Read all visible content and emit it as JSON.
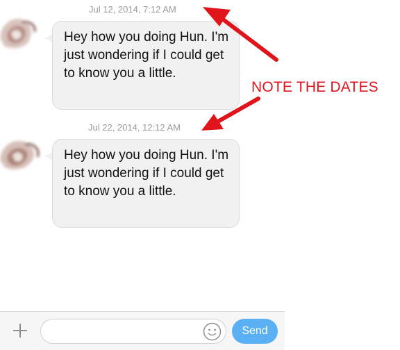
{
  "messages": [
    {
      "timestamp": "Jul 12, 2014, 7:12 AM",
      "text": "Hey how you doing Hun. I'm just wondering if I could get to know you a little."
    },
    {
      "timestamp": "Jul 22, 2014, 12:12 AM",
      "text": "Hey how you doing Hun. I'm just wondering if I could get to know you a little."
    }
  ],
  "annotation": {
    "label": "NOTE THE DATES",
    "color": "#e0151b"
  },
  "composer": {
    "plus_icon": "plus-icon",
    "placeholder": "",
    "emoji_icon": "smiley-icon",
    "send_label": "Send",
    "send_color": "#5ab0f2"
  }
}
